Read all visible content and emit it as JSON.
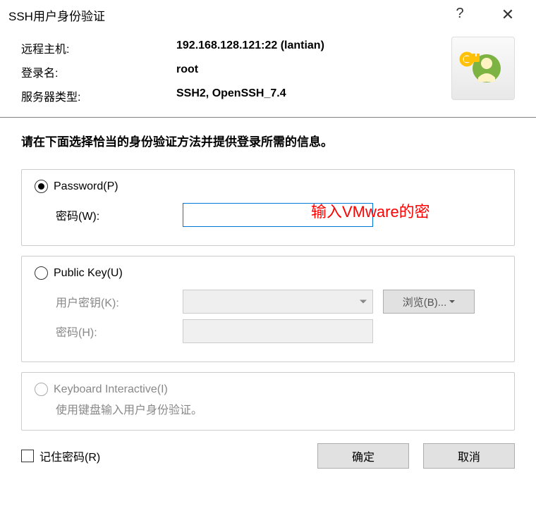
{
  "title": "SSH用户身份验证",
  "info": {
    "remote_host_label": "远程主机:",
    "remote_host_value": "192.168.128.121:22 (lantian)",
    "login_label": "登录名:",
    "login_value": "root",
    "server_type_label": "服务器类型:",
    "server_type_value": "SSH2, OpenSSH_7.4"
  },
  "instruction": "请在下面选择恰当的身份验证方法并提供登录所需的信息。",
  "password_section": {
    "radio_label": "Password(P)",
    "field_label": "密码(W):"
  },
  "publickey_section": {
    "radio_label": "Public Key(U)",
    "userkey_label": "用户密钥(K):",
    "password_label": "密码(H):",
    "browse_label": "浏览(B)..."
  },
  "keyboard_section": {
    "radio_label": "Keyboard Interactive(I)",
    "subtext": "使用键盘输入用户身份验证。"
  },
  "remember_label": "记住密码(R)",
  "ok_label": "确定",
  "cancel_label": "取消",
  "annotation": "输入VMware的密"
}
